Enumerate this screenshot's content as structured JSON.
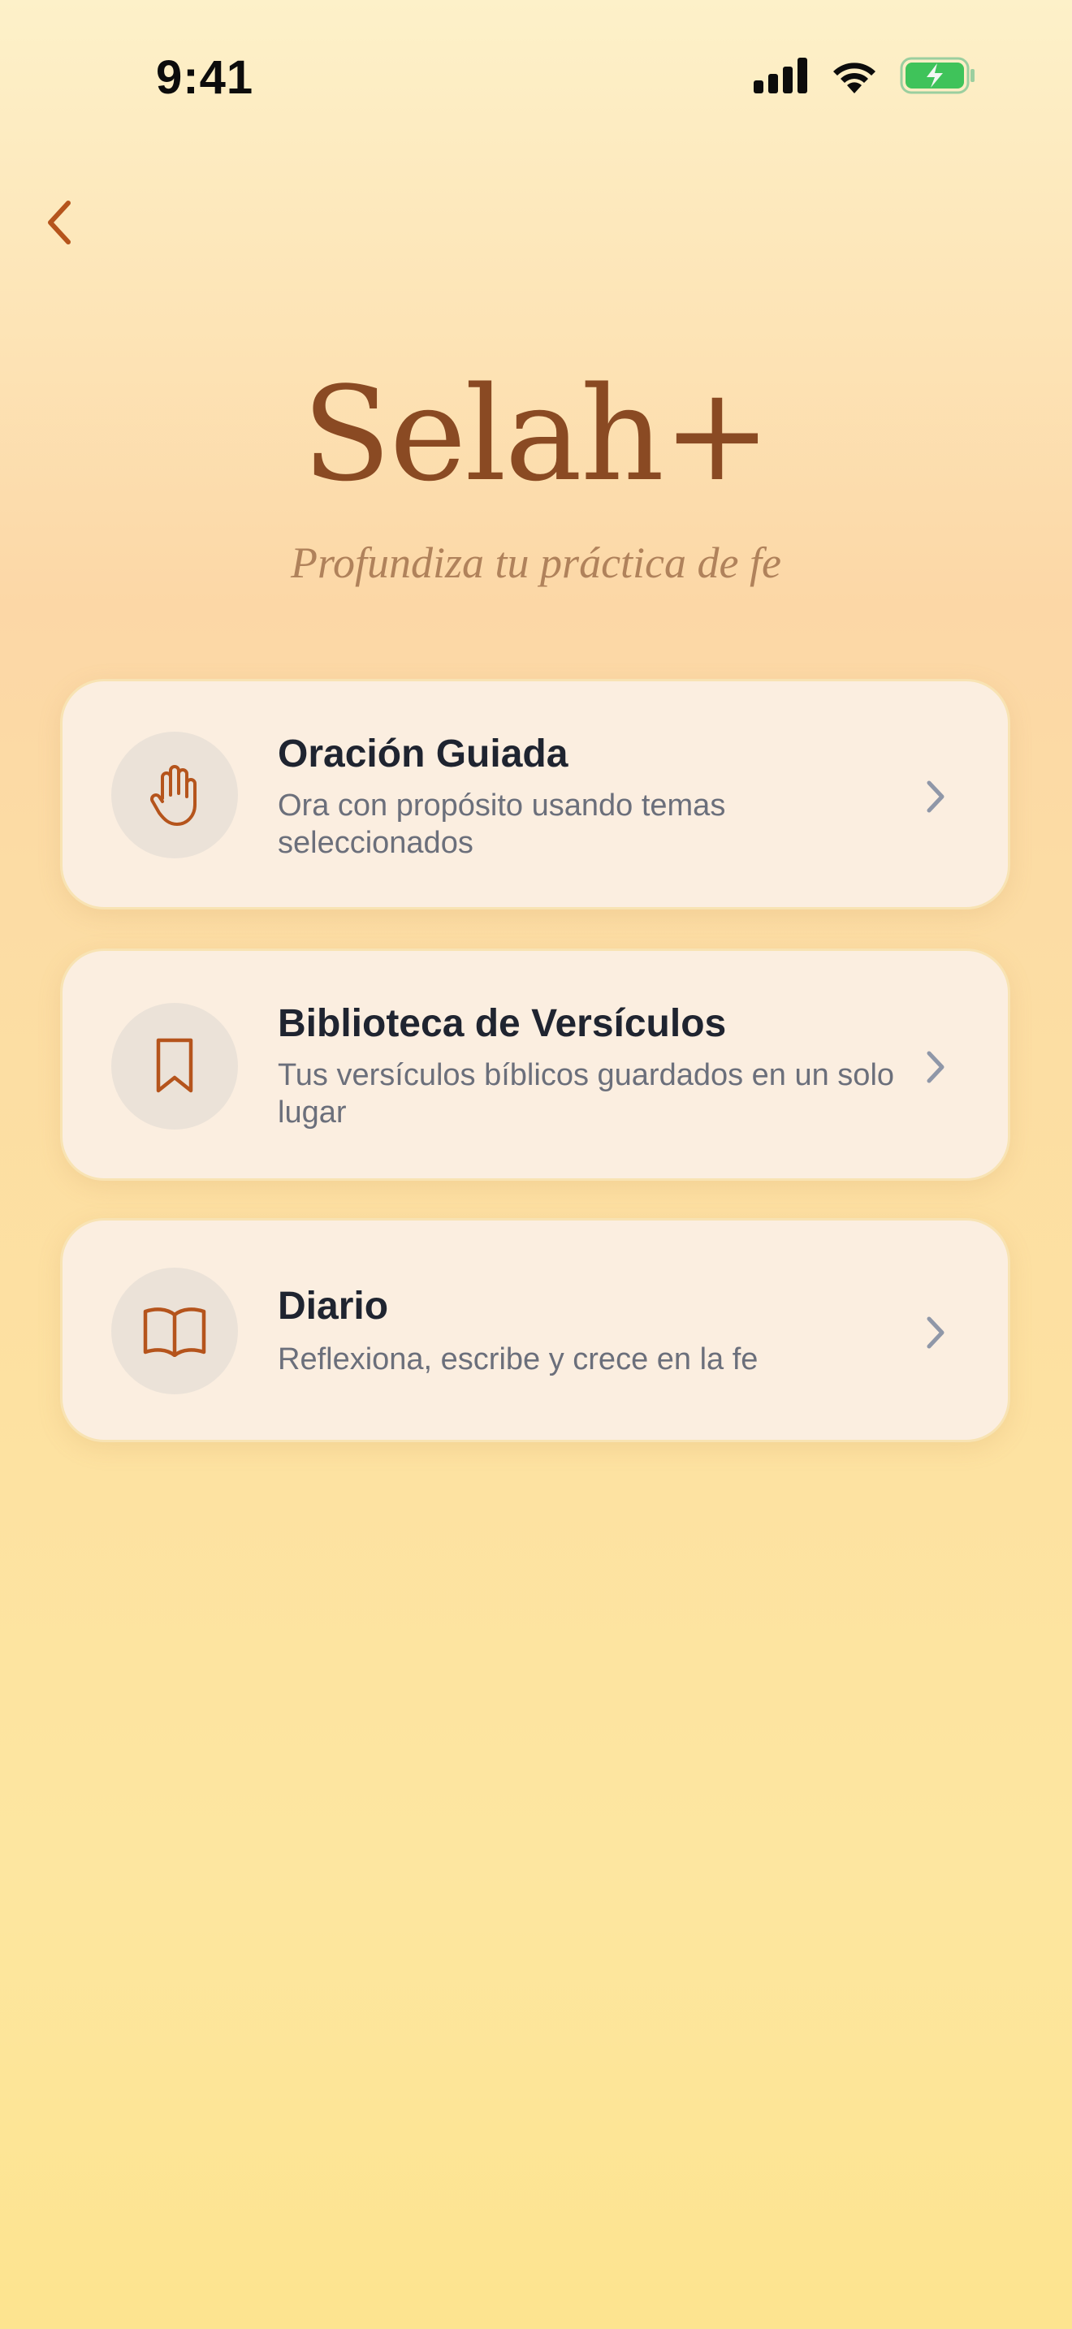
{
  "status_bar": {
    "time": "9:41",
    "icons": [
      "cellular-signal-icon",
      "wifi-icon",
      "battery-charging-icon"
    ],
    "battery_color": "#3fc35a"
  },
  "nav": {
    "back_icon": "chevron-left-icon",
    "accent_color": "#b5541c"
  },
  "header": {
    "title": "Selah+",
    "tagline": "Profundiza tu práctica de fe"
  },
  "menu": [
    {
      "icon": "raised-hand-icon",
      "title": "Oración Guiada",
      "description": "Ora con propósito usando temas seleccionados"
    },
    {
      "icon": "bookmark-icon",
      "title": "Biblioteca de Versículos",
      "description": "Tus versículos bíblicos guardados en un solo lugar"
    },
    {
      "icon": "open-book-icon",
      "title": "Diario",
      "description": "Reflexiona, escribe y crece en la fe"
    }
  ],
  "colors": {
    "title": "#8a4a23",
    "icon_accent": "#b5541c",
    "chevron": "#8f97a8"
  }
}
